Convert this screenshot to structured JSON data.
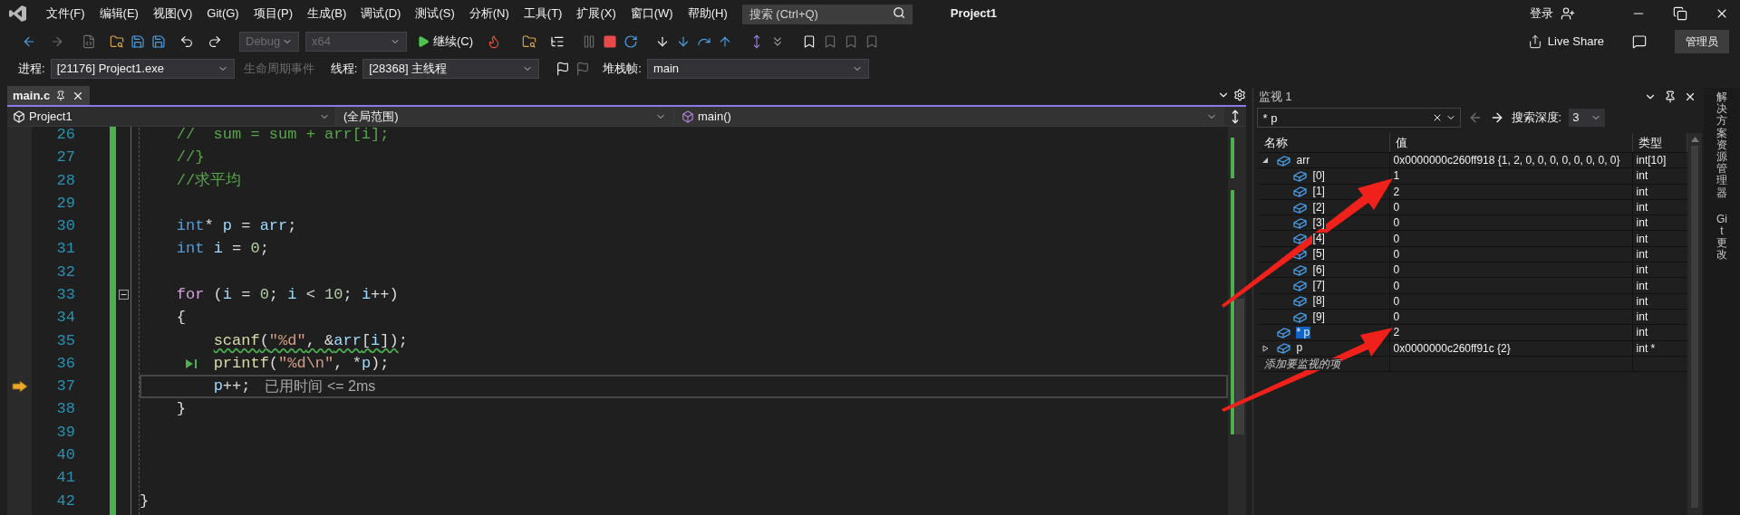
{
  "menu": [
    "文件(F)",
    "编辑(E)",
    "视图(V)",
    "Git(G)",
    "项目(P)",
    "生成(B)",
    "调试(D)",
    "测试(S)",
    "分析(N)",
    "工具(T)",
    "扩展(X)",
    "窗口(W)",
    "帮助(H)"
  ],
  "search": {
    "placeholder": "搜索 (Ctrl+Q)"
  },
  "solution_title": "Project1",
  "account": {
    "login": "登录"
  },
  "toolbar": {
    "configuration": "Debug",
    "platform": "x64",
    "continue": "继续(C)",
    "live_share": "Live Share",
    "admin_badge": "管理员"
  },
  "debug_location": {
    "process_label": "进程:",
    "process": "[21176] Project1.exe",
    "lifecycle": "生命周期事件",
    "thread_label": "线程:",
    "thread": "[28368] 主线程",
    "stack_label": "堆栈帧:",
    "stack": "main"
  },
  "document_tabs": [
    {
      "label": "main.c",
      "selected": true
    }
  ],
  "nav_bar": {
    "project": "Project1",
    "scope": "(全局范围)",
    "member": "main()"
  },
  "editor": {
    "lines": [
      {
        "number": "26",
        "tokens": [
          {
            "kind": "comment",
            "text": "    //  sum = sum + arr[i];"
          }
        ]
      },
      {
        "number": "27",
        "tokens": [
          {
            "kind": "comment",
            "text": "    //}"
          }
        ]
      },
      {
        "number": "28",
        "tokens": [
          {
            "kind": "comment",
            "text": "    //求平均"
          }
        ]
      },
      {
        "number": "29"
      },
      {
        "number": "30",
        "tokens": [
          {
            "kind": "keyword",
            "text": "    int"
          },
          {
            "kind": "plain",
            "text": "* "
          },
          {
            "kind": "variable",
            "text": "p"
          },
          {
            "kind": "plain",
            "text": " = "
          },
          {
            "kind": "variable",
            "text": "arr"
          },
          {
            "kind": "plain",
            "text": ";"
          }
        ]
      },
      {
        "number": "31",
        "tokens": [
          {
            "kind": "keyword",
            "text": "    int "
          },
          {
            "kind": "variable",
            "text": "i"
          },
          {
            "kind": "plain",
            "text": " = "
          },
          {
            "kind": "number",
            "text": "0"
          },
          {
            "kind": "plain",
            "text": ";"
          }
        ]
      },
      {
        "number": "32"
      },
      {
        "number": "33",
        "foldable": true,
        "tokens": [
          {
            "kind": "control",
            "text": "    for"
          },
          {
            "kind": "plain",
            "text": " ("
          },
          {
            "kind": "variable",
            "text": "i"
          },
          {
            "kind": "plain",
            "text": " = "
          },
          {
            "kind": "number",
            "text": "0"
          },
          {
            "kind": "plain",
            "text": "; "
          },
          {
            "kind": "variable",
            "text": "i"
          },
          {
            "kind": "plain",
            "text": " < "
          },
          {
            "kind": "number",
            "text": "10"
          },
          {
            "kind": "plain",
            "text": "; "
          },
          {
            "kind": "variable",
            "text": "i"
          },
          {
            "kind": "plain",
            "text": "++)"
          }
        ]
      },
      {
        "number": "34",
        "tokens": [
          {
            "kind": "plain",
            "text": "    {"
          }
        ]
      },
      {
        "number": "35",
        "tokens": [
          {
            "kind": "function",
            "text": "        scanf",
            "squiggle": true
          },
          {
            "kind": "plain",
            "text": "(",
            "squiggle": true
          },
          {
            "kind": "string",
            "text": "\"%d\"",
            "squiggle": true
          },
          {
            "kind": "plain",
            "text": ", &",
            "squiggle": true
          },
          {
            "kind": "variable",
            "text": "arr",
            "squiggle": true
          },
          {
            "kind": "plain",
            "text": "[",
            "squiggle": true
          },
          {
            "kind": "variable",
            "text": "i",
            "squiggle": true
          },
          {
            "kind": "plain",
            "text": "])",
            "squiggle": true
          },
          {
            "kind": "plain",
            "text": ";",
            "squiggle": false
          }
        ]
      },
      {
        "number": "36",
        "run_to_click": true,
        "tokens": [
          {
            "kind": "function",
            "text": "        printf"
          },
          {
            "kind": "plain",
            "text": "("
          },
          {
            "kind": "string",
            "text": "\"%d\\n\""
          },
          {
            "kind": "plain",
            "text": ", *"
          },
          {
            "kind": "variable",
            "text": "p"
          },
          {
            "kind": "plain",
            "text": ");"
          }
        ]
      },
      {
        "number": "37",
        "current": true,
        "hint": "已用时间 <= 2ms",
        "tokens": [
          {
            "kind": "variable",
            "text": "        p"
          },
          {
            "kind": "plain",
            "text": "++;"
          }
        ]
      },
      {
        "number": "38",
        "tokens": [
          {
            "kind": "plain",
            "text": "    }"
          }
        ]
      },
      {
        "number": "39"
      },
      {
        "number": "40"
      },
      {
        "number": "41"
      },
      {
        "number": "42",
        "tokens": [
          {
            "kind": "plain",
            "text": "}"
          }
        ]
      }
    ]
  },
  "watch": {
    "title": "监视 1",
    "search_value": "* p",
    "depth_label": "搜索深度:",
    "depth": "3",
    "columns": [
      "名称",
      "值",
      "类型"
    ],
    "rows": [
      {
        "name": "arr",
        "value": "0x0000000c260ff918 {1, 2, 0, 0, 0, 0, 0, 0, 0, 0}",
        "type": "int[10]",
        "selected": false,
        "expanded": true,
        "children": [
          {
            "name": "[0]",
            "value": "1",
            "type": "int",
            "selected": false
          },
          {
            "name": "[1]",
            "value": "2",
            "type": "int",
            "selected": false
          },
          {
            "name": "[2]",
            "value": "0",
            "type": "int",
            "selected": false
          },
          {
            "name": "[3]",
            "value": "0",
            "type": "int",
            "selected": false
          },
          {
            "name": "[4]",
            "value": "0",
            "type": "int",
            "selected": false
          },
          {
            "name": "[5]",
            "value": "0",
            "type": "int",
            "selected": false
          },
          {
            "name": "[6]",
            "value": "0",
            "type": "int",
            "selected": false
          },
          {
            "name": "[7]",
            "value": "0",
            "type": "int",
            "selected": false
          },
          {
            "name": "[8]",
            "value": "0",
            "type": "int",
            "selected": false
          },
          {
            "name": "[9]",
            "value": "0",
            "type": "int",
            "selected": false
          }
        ]
      },
      {
        "name": "* p",
        "value": "2",
        "type": "int",
        "selected": true
      },
      {
        "name": "p",
        "value": "0x0000000c260ff91c {2}",
        "type": "int *",
        "selected": false,
        "expanded": false
      }
    ],
    "add_placeholder": "添加要监视的项"
  },
  "side_tabs": [
    "解决方案资源管理器",
    "Git 更改"
  ]
}
